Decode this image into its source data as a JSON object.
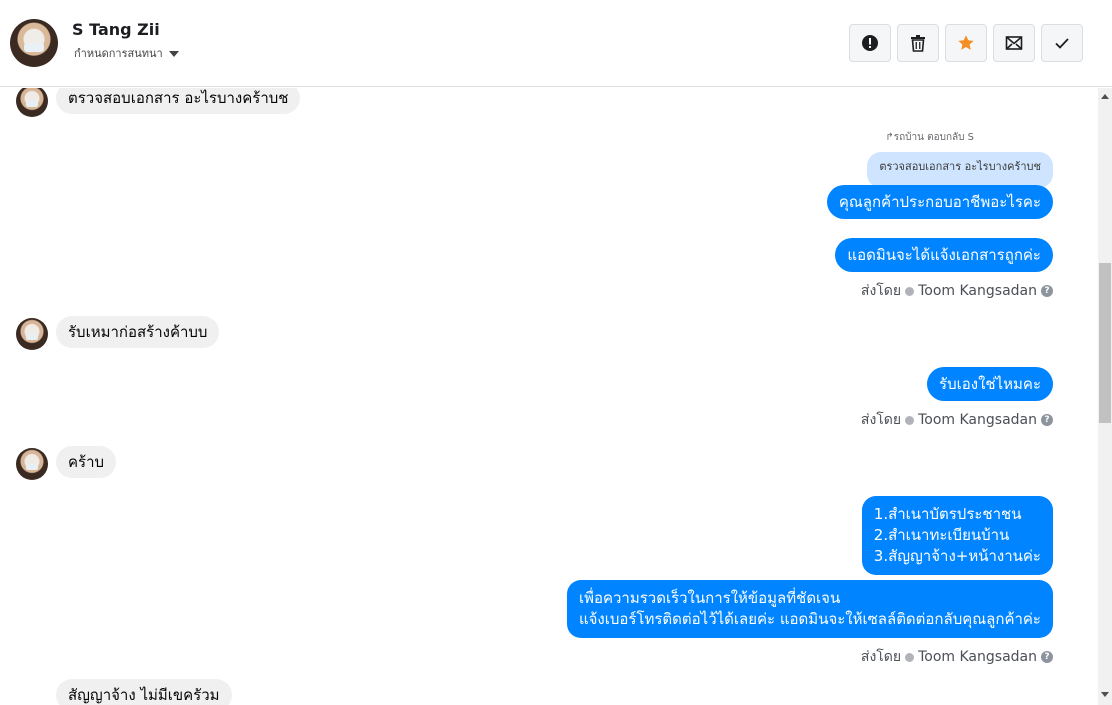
{
  "header": {
    "contact_name": "S Tang Zii",
    "assign_label": "กำหนดการสนทนา",
    "actions": [
      {
        "name": "spam",
        "icon": "alert-icon"
      },
      {
        "name": "delete",
        "icon": "trash-icon"
      },
      {
        "name": "star",
        "icon": "star-icon",
        "color": "#f48f25"
      },
      {
        "name": "mark-unread",
        "icon": "envelope-icon"
      },
      {
        "name": "done",
        "icon": "check-icon"
      }
    ]
  },
  "messages": {
    "m1": "ตรวจสอบเอกสาร อะไรบางคร้าบช",
    "reply_label": "↱รถบ้าน ตอบกลับ S",
    "reply_quote": "ตรวจสอบเอกสาร อะไรบางคร้าบช",
    "m2": "คุณลูกค้าประกอบอาชีพอะไรคะ",
    "m3": "แอดมินจะได้แจ้งเอกสารถูกค่ะ",
    "m4": "รับเหมาก่อสร้างค้าบบ",
    "m5": "รับเองใช่ไหมคะ",
    "m6": "คร้าบ",
    "m7_lines": [
      "1.สำเนาบัตรประชาชน",
      "2.สำเนาทะเบียนบ้าน",
      "3.สัญญาจ้าง+หน้างานค่ะ"
    ],
    "m8_lines": [
      "เพื่อความรวดเร็วในการให้ข้อมูลที่ชัดเจน",
      "แจ้งเบอร์โทรติดต่อไว้ได้เลยค่ะ แอดมินจะให้เซลล์ติดต่อกลับคุณลูกค้าค่ะ"
    ],
    "m9": "สัญญาจ้าง ไม่มีเขครัวม"
  },
  "sent_by": {
    "prefix": "ส่งโดย",
    "agent": "Toom Kangsadan",
    "help": "?"
  },
  "colors": {
    "outgoing": "#0084ff",
    "incoming": "#f0f0f0",
    "reply_quote": "#cfe5ff"
  }
}
